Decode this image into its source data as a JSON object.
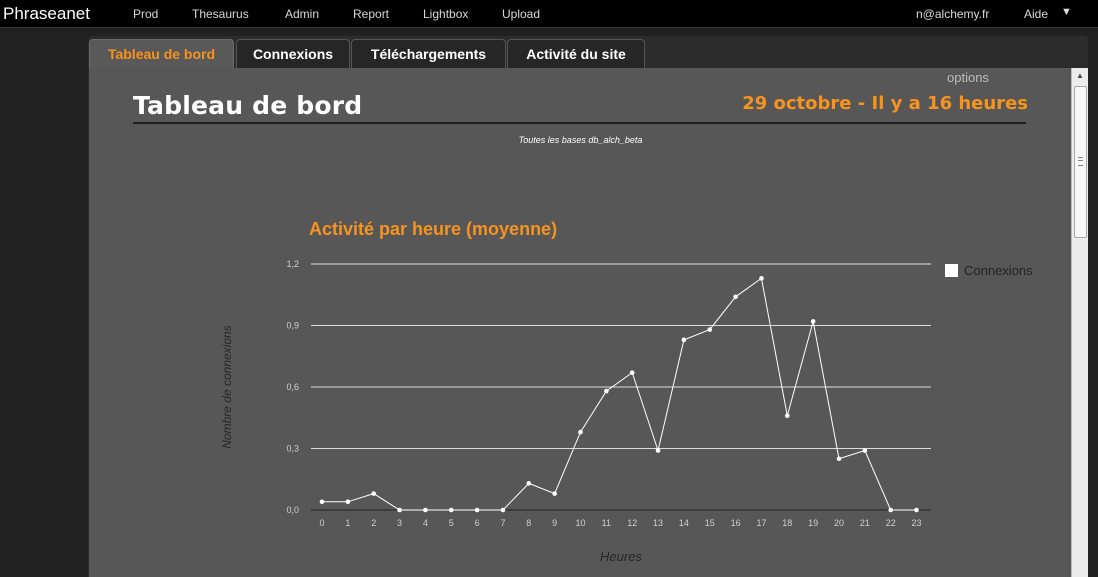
{
  "app": {
    "brand": "Phraseanet"
  },
  "nav": {
    "items": [
      "Prod",
      "Thesaurus",
      "Admin",
      "Report",
      "Lightbox",
      "Upload"
    ],
    "user": "n@alchemy.fr",
    "help": "Aide",
    "menu_caret": "▼"
  },
  "tabs": [
    {
      "label": "Tableau de bord",
      "active": true
    },
    {
      "label": "Connexions",
      "active": false
    },
    {
      "label": "Téléchargements",
      "active": false
    },
    {
      "label": "Activité du site",
      "active": false
    }
  ],
  "dashboard": {
    "options_label": "options",
    "title": "Tableau de bord",
    "date_label": "29 octobre - Il y a 16 heures",
    "databases_label": "Toutes les bases db_alch_beta"
  },
  "chart_data": {
    "type": "line",
    "title": "Activité par heure (moyenne)",
    "xlabel": "Heures",
    "ylabel": "Nombre de connexions",
    "categories": [
      "0",
      "1",
      "2",
      "3",
      "4",
      "5",
      "6",
      "7",
      "8",
      "9",
      "10",
      "11",
      "12",
      "13",
      "14",
      "15",
      "16",
      "17",
      "18",
      "19",
      "20",
      "21",
      "22",
      "23"
    ],
    "series": [
      {
        "name": "Connexions",
        "values": [
          0.04,
          0.04,
          0.08,
          0,
          0,
          0,
          0,
          0,
          0.13,
          0.08,
          0.38,
          0.58,
          0.67,
          0.29,
          0.83,
          0.88,
          1.04,
          1.13,
          0.46,
          0.92,
          0.25,
          0.29,
          0,
          0
        ]
      }
    ],
    "ylim": [
      0,
      1.2
    ],
    "yticks": [
      "0,0",
      "0,3",
      "0,6",
      "0,9",
      "1,2"
    ],
    "grid": true,
    "legend": "right",
    "colors": {
      "line": "#ffffff",
      "grid": "#dddddd",
      "title": "#f7931e"
    }
  }
}
